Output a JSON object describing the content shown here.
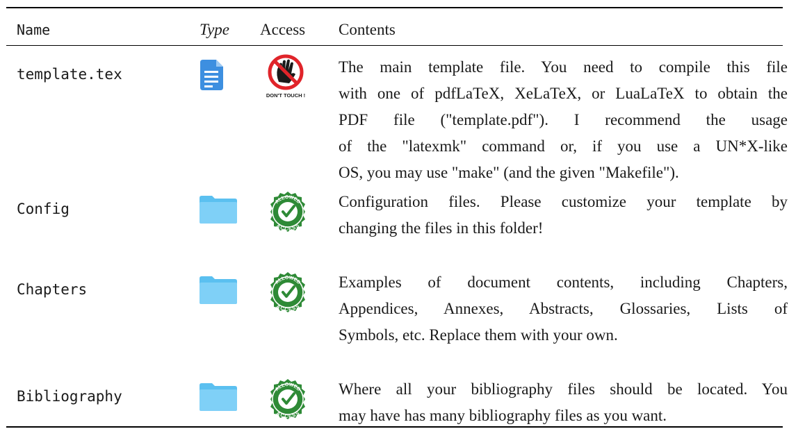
{
  "headers": {
    "name": "Name",
    "type": "Type",
    "access": "Access",
    "contents": "Contents"
  },
  "rows": [
    {
      "name": "template.tex",
      "type_icon": "document-icon",
      "access_icon": "dont-touch-icon",
      "access_label": "DON'T TOUCH !",
      "lines": [
        "The main template file. You need to compile this file",
        "with one of pdfLaTeX, XeLaTeX, or LuaLaTeX to obtain the",
        "PDF file (\"template.pdf\"). I recommend the usage",
        "of the \"latexmk\" command or, if you use a UN*X-like",
        "OS, you may use \"make\" (and the given \"Makefile\")."
      ]
    },
    {
      "name": "Config",
      "type_icon": "folder-icon",
      "access_icon": "allowed-access-icon",
      "access_label_top": "ALLOWED",
      "access_label_bottom": "ACCESS",
      "lines": [
        "Configuration files. Please customize your template by",
        "changing the files in this folder!"
      ]
    },
    {
      "name": "Chapters",
      "type_icon": "folder-icon",
      "access_icon": "allowed-access-icon",
      "access_label_top": "ALLOWED",
      "access_label_bottom": "ACCESS",
      "lines": [
        "Examples of document contents, including Chapters,",
        "Appendices, Annexes, Abstracts, Glossaries, Lists of",
        "Symbols, etc. Replace them with your own."
      ]
    },
    {
      "name": "Bibliography",
      "type_icon": "folder-icon",
      "access_icon": "allowed-access-icon",
      "access_label_top": "ALLOWED",
      "access_label_bottom": "ACCESS",
      "lines": [
        "Where all your bibliography files should be located. You",
        "may have has many bibliography files as you want."
      ]
    }
  ],
  "colors": {
    "doc_icon": "#3d8fe0",
    "folder_icon": "#5bc0f0",
    "badge_green": "#2e8a36",
    "stop_red": "#e0242a"
  }
}
